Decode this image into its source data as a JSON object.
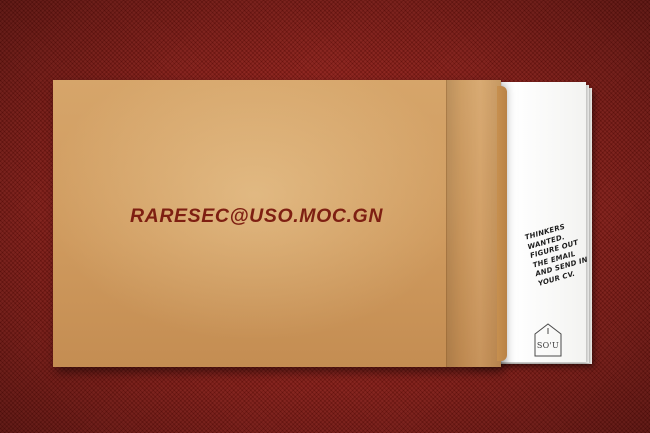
{
  "envelope": {
    "email_text": "RARESEC@USO.MOC.GN"
  },
  "insert": {
    "tagline_lines": [
      "THINKERS",
      "WANTED.",
      "FIGURE OUT",
      "THE EMAIL",
      "AND SEND IN",
      "YOUR CV."
    ],
    "logo_text": "SO'U"
  },
  "colors": {
    "background_fabric": "#8d1a14",
    "envelope": "#d2a062",
    "email_ink": "#7e1f12",
    "paper": "#f8f8f6"
  }
}
